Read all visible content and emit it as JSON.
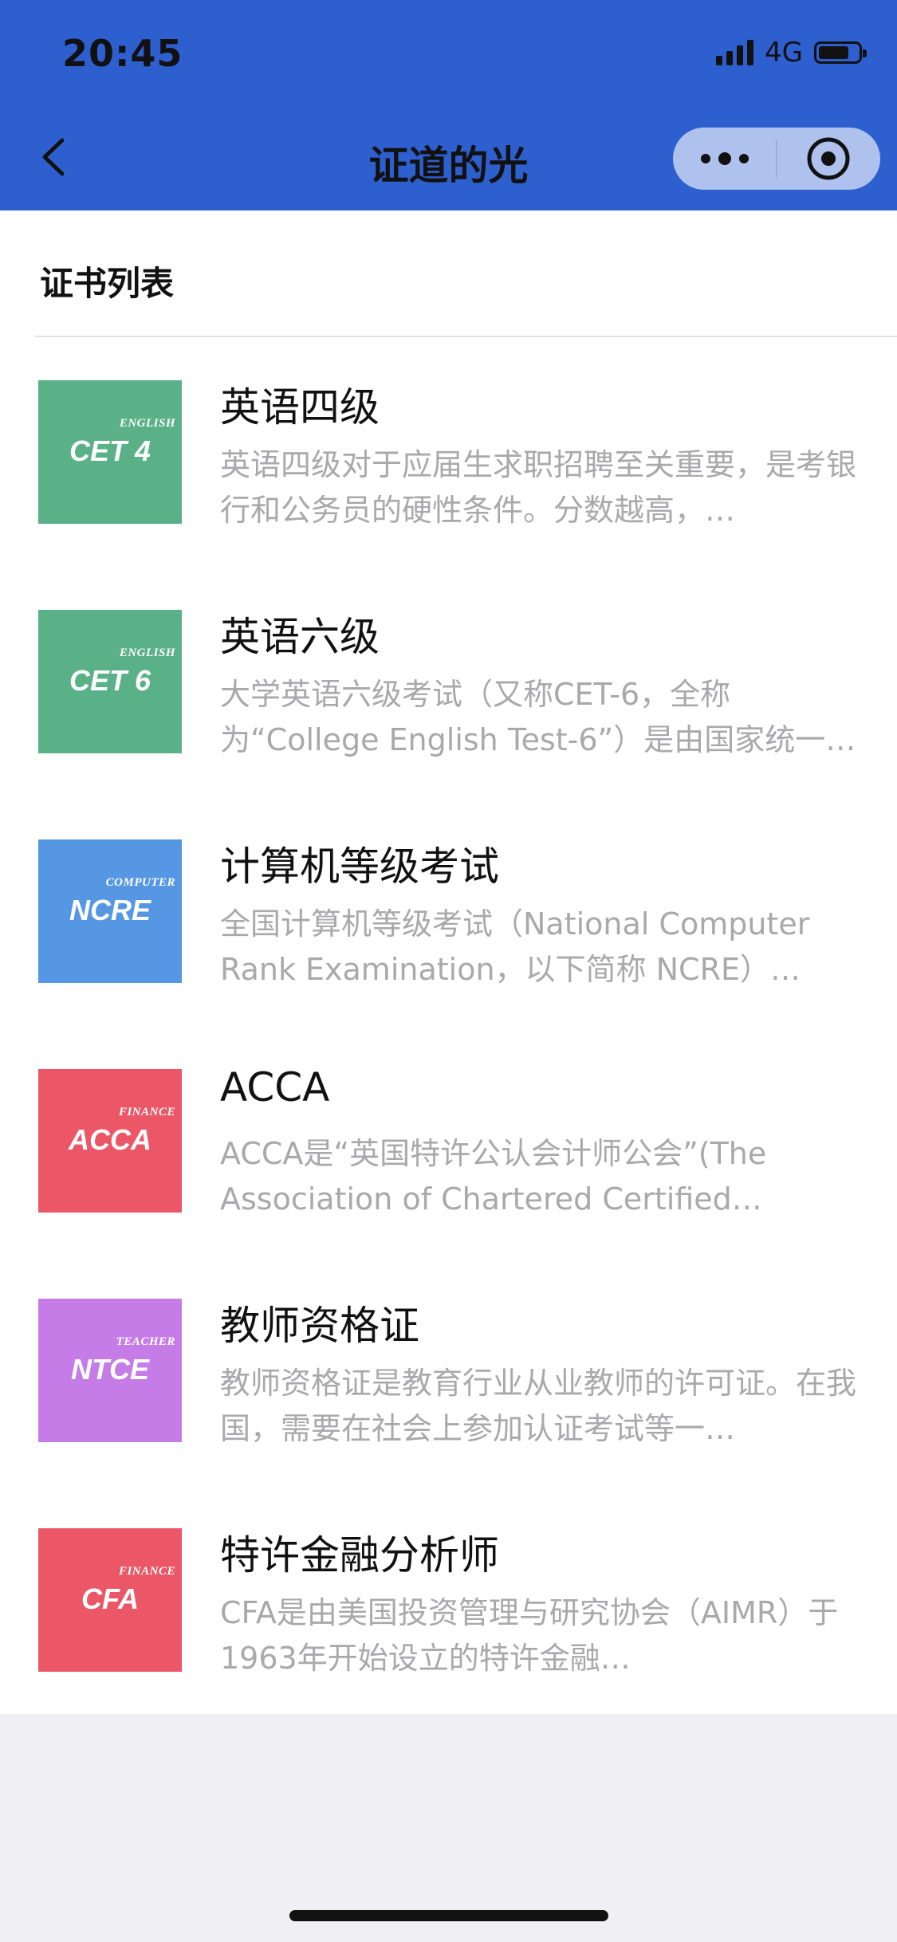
{
  "status_bar": {
    "time": "20:45",
    "network": "4G"
  },
  "nav": {
    "title": "证道的光",
    "back_icon": "chevron-left-icon",
    "more_icon": "more-dots-icon",
    "close_icon": "target-icon"
  },
  "section": {
    "title": "证书列表"
  },
  "items": [
    {
      "thumb_category": "ENGLISH",
      "thumb_code": "CET 4",
      "thumb_color": "#5bb187",
      "title": "英语四级",
      "desc": "英语四级对于应届生求职招聘至关重要，是考银行和公务员的硬性条件。分数越高，…"
    },
    {
      "thumb_category": "ENGLISH",
      "thumb_code": "CET 6",
      "thumb_color": "#5bb187",
      "title": "英语六级",
      "desc": "大学英语六级考试（又称CET-6，全称为“College English Test-6”）是由国家统一…"
    },
    {
      "thumb_category": "COMPUTER",
      "thumb_code": "NCRE",
      "thumb_color": "#5597e2",
      "title": "计算机等级考试",
      "desc": "全国计算机等级考试（National Computer Rank Examination，以下简称 NCRE）…"
    },
    {
      "thumb_category": "FINANCE",
      "thumb_code": "ACCA",
      "thumb_color": "#eb5766",
      "title": "ACCA",
      "desc": "ACCA是“英国特许公认会计师公会”(The Association of Chartered Certified…"
    },
    {
      "thumb_category": "TEACHER",
      "thumb_code": "NTCE",
      "thumb_color": "#c67ce6",
      "title": "教师资格证",
      "desc": "教师资格证是教育行业从业教师的许可证。在我国，需要在社会上参加认证考试等一…"
    },
    {
      "thumb_category": "FINANCE",
      "thumb_code": "CFA",
      "thumb_color": "#eb5766",
      "title": "特许金融分析师",
      "desc": "CFA是由美国投资管理与研究协会（AIMR）于1963年开始设立的特许金融…"
    }
  ],
  "colors": {
    "brand_blue": "#2e5fcf",
    "desc_gray": "#a9a9ab",
    "page_bg": "#efeff4"
  }
}
